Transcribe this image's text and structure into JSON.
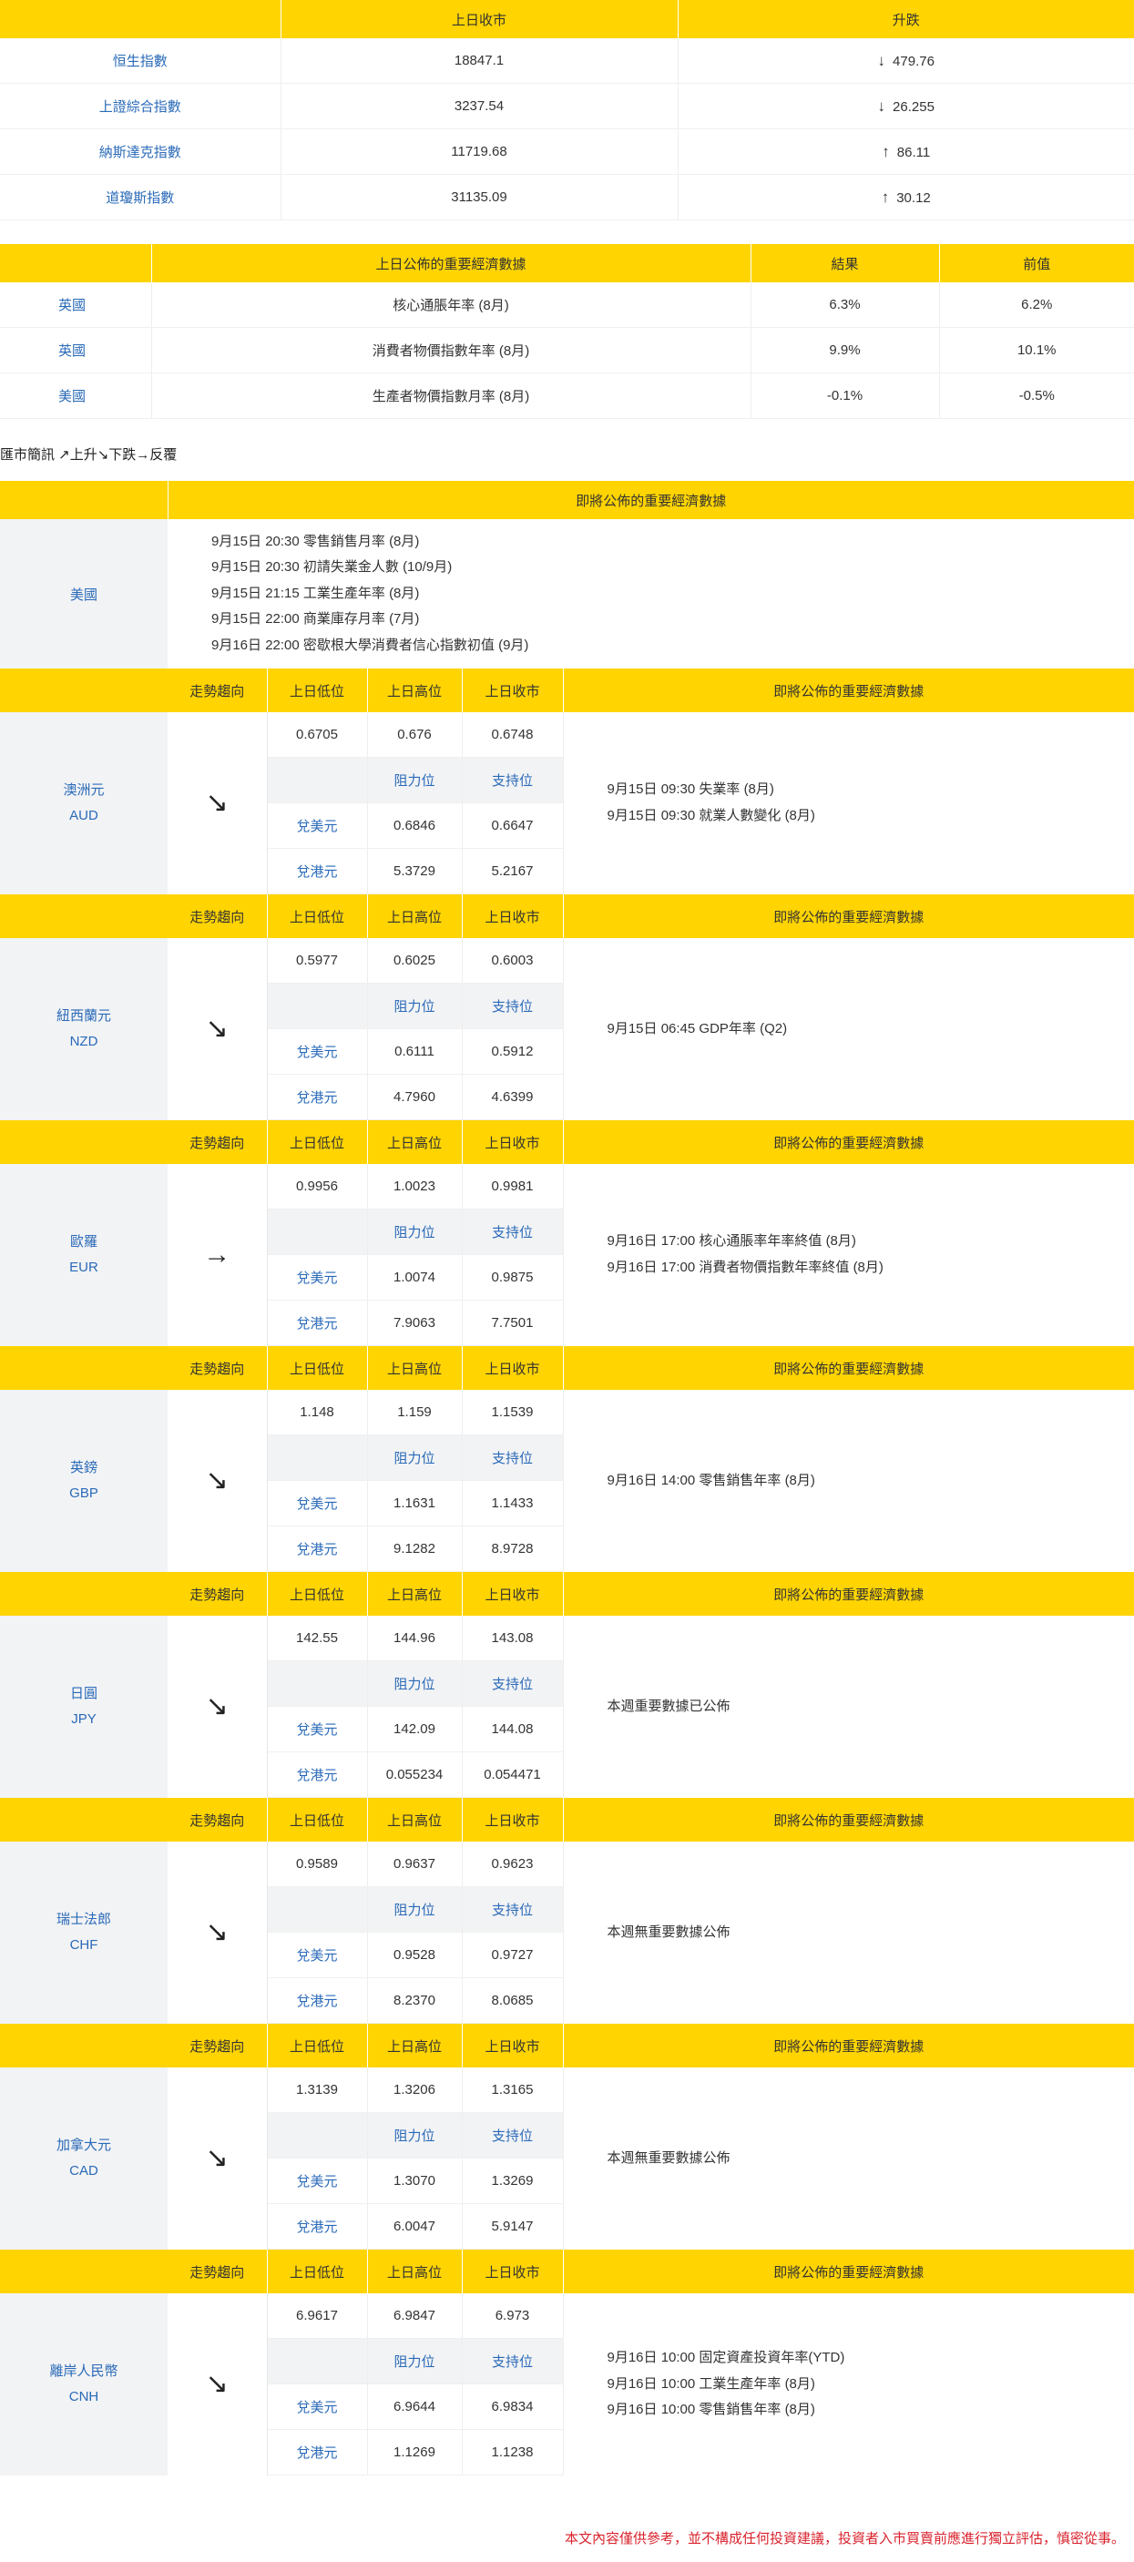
{
  "index_table": {
    "headers": [
      "",
      "上日收市",
      "升跌"
    ],
    "rows": [
      {
        "name": "恒生指數",
        "close": "18847.1",
        "dir": "↓",
        "change": "479.76"
      },
      {
        "name": "上證綜合指數",
        "close": "3237.54",
        "dir": "↓",
        "change": "26.255"
      },
      {
        "name": "納斯達克指數",
        "close": "11719.68",
        "dir": "↑",
        "change": "86.11"
      },
      {
        "name": "道瓊斯指數",
        "close": "31135.09",
        "dir": "↑",
        "change": "30.12"
      }
    ]
  },
  "econ_table": {
    "headers": [
      "",
      "上日公佈的重要經濟數據",
      "結果",
      "前值"
    ],
    "rows": [
      {
        "country": "英國",
        "item": "核心通脹年率 (8月)",
        "result": "6.3%",
        "prev": "6.2%"
      },
      {
        "country": "英國",
        "item": "消費者物價指數年率 (8月)",
        "result": "9.9%",
        "prev": "10.1%"
      },
      {
        "country": "美國",
        "item": "生產者物價指數月率 (8月)",
        "result": "-0.1%",
        "prev": "-0.5%"
      }
    ]
  },
  "legend": "匯市簡訊 ↗上升↘下跌→反覆",
  "upcoming_us": {
    "header": "即將公佈的重要經濟數據",
    "country": "美國",
    "events": [
      "9月15日 20:30 零售銷售月率 (8月)",
      "9月15日 20:30 初請失業金人數 (10/9月)",
      "9月15日 21:15 工業生產年率 (8月)",
      "9月15日 22:00 商業庫存月率 (7月)",
      "9月16日 22:00 密歇根大學消費者信心指數初值 (9月)"
    ]
  },
  "currency_headers": {
    "trend": "走勢趨向",
    "low": "上日低位",
    "high": "上日高位",
    "close": "上日收市",
    "events": "即將公佈的重要經濟數據",
    "resistance": "阻力位",
    "support": "支持位",
    "usd": "兌美元",
    "hkd": "兌港元"
  },
  "currencies": [
    {
      "name": "澳洲元",
      "code": "AUD",
      "trend": "↘",
      "low": "0.6705",
      "high": "0.676",
      "close": "0.6748",
      "usd_res": "0.6846",
      "usd_sup": "0.6647",
      "hkd_res": "5.3729",
      "hkd_sup": "5.2167",
      "events": [
        "9月15日 09:30 失業率 (8月)",
        "9月15日 09:30 就業人數變化 (8月)"
      ]
    },
    {
      "name": "紐西蘭元",
      "code": "NZD",
      "trend": "↘",
      "low": "0.5977",
      "high": "0.6025",
      "close": "0.6003",
      "usd_res": "0.6111",
      "usd_sup": "0.5912",
      "hkd_res": "4.7960",
      "hkd_sup": "4.6399",
      "events": [
        "9月15日 06:45 GDP年率 (Q2)"
      ]
    },
    {
      "name": "歐羅",
      "code": "EUR",
      "trend": "→",
      "low": "0.9956",
      "high": "1.0023",
      "close": "0.9981",
      "usd_res": "1.0074",
      "usd_sup": "0.9875",
      "hkd_res": "7.9063",
      "hkd_sup": "7.7501",
      "events": [
        "9月16日 17:00 核心通脹率年率終值 (8月)",
        "9月16日 17:00 消費者物價指數年率終值 (8月)"
      ]
    },
    {
      "name": "英鎊",
      "code": "GBP",
      "trend": "↘",
      "low": "1.148",
      "high": "1.159",
      "close": "1.1539",
      "usd_res": "1.1631",
      "usd_sup": "1.1433",
      "hkd_res": "9.1282",
      "hkd_sup": "8.9728",
      "events": [
        "9月16日 14:00 零售銷售年率 (8月)"
      ]
    },
    {
      "name": "日圓",
      "code": "JPY",
      "trend": "↘",
      "low": "142.55",
      "high": "144.96",
      "close": "143.08",
      "usd_res": "142.09",
      "usd_sup": "144.08",
      "hkd_res": "0.055234",
      "hkd_sup": "0.054471",
      "events": [
        "本週重要數據已公佈"
      ]
    },
    {
      "name": "瑞士法郎",
      "code": "CHF",
      "trend": "↘",
      "low": "0.9589",
      "high": "0.9637",
      "close": "0.9623",
      "usd_res": "0.9528",
      "usd_sup": "0.9727",
      "hkd_res": "8.2370",
      "hkd_sup": "8.0685",
      "events": [
        "本週無重要數據公佈"
      ]
    },
    {
      "name": "加拿大元",
      "code": "CAD",
      "trend": "↘",
      "low": "1.3139",
      "high": "1.3206",
      "close": "1.3165",
      "usd_res": "1.3070",
      "usd_sup": "1.3269",
      "hkd_res": "6.0047",
      "hkd_sup": "5.9147",
      "events": [
        "本週無重要數據公佈"
      ]
    },
    {
      "name": "離岸人民幣",
      "code": "CNH",
      "trend": "↘",
      "low": "6.9617",
      "high": "6.9847",
      "close": "6.973",
      "usd_res": "6.9644",
      "usd_sup": "6.9834",
      "hkd_res": "1.1269",
      "hkd_sup": "1.1238",
      "events": [
        "9月16日 10:00 固定資產投資年率(YTD)",
        "9月16日 10:00 工業生產年率 (8月)",
        "9月16日 10:00 零售銷售年率 (8月)"
      ]
    }
  ],
  "disclaimer": "本文內容僅供參考，並不構成任何投資建議，投資者入市買賣前應進行獨立評估，慎密從事。",
  "colors": {
    "header_bg": "#ffd400",
    "link": "#2a6ab8",
    "label_bg": "#f2f3f5",
    "disclaimer": "#d9232d"
  }
}
